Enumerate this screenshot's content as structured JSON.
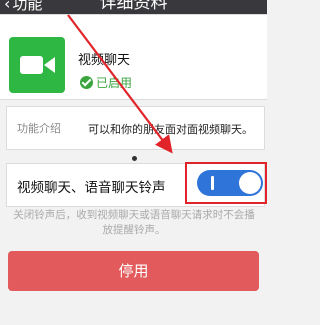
{
  "header": {
    "back_label": "功能",
    "title": "详细资料"
  },
  "app": {
    "name": "视频聊天",
    "status": "已启用",
    "icon": "video-camera-icon",
    "icon_color": "#2fb744"
  },
  "intro": {
    "label": "功能介绍",
    "text": "可以和你的朋友面对面视频聊天。"
  },
  "ringtone": {
    "label": "视频聊天、语音聊天铃声",
    "enabled": true
  },
  "hint": "关闭铃声后，收到视频聊天或语音聊天请求时不会播放提醒铃声。",
  "stop_button": "停用",
  "colors": {
    "accent_green": "#2fb744",
    "toggle_blue": "#2f74d9",
    "danger_red": "#e25a5b",
    "highlight_red": "#e1242a"
  }
}
